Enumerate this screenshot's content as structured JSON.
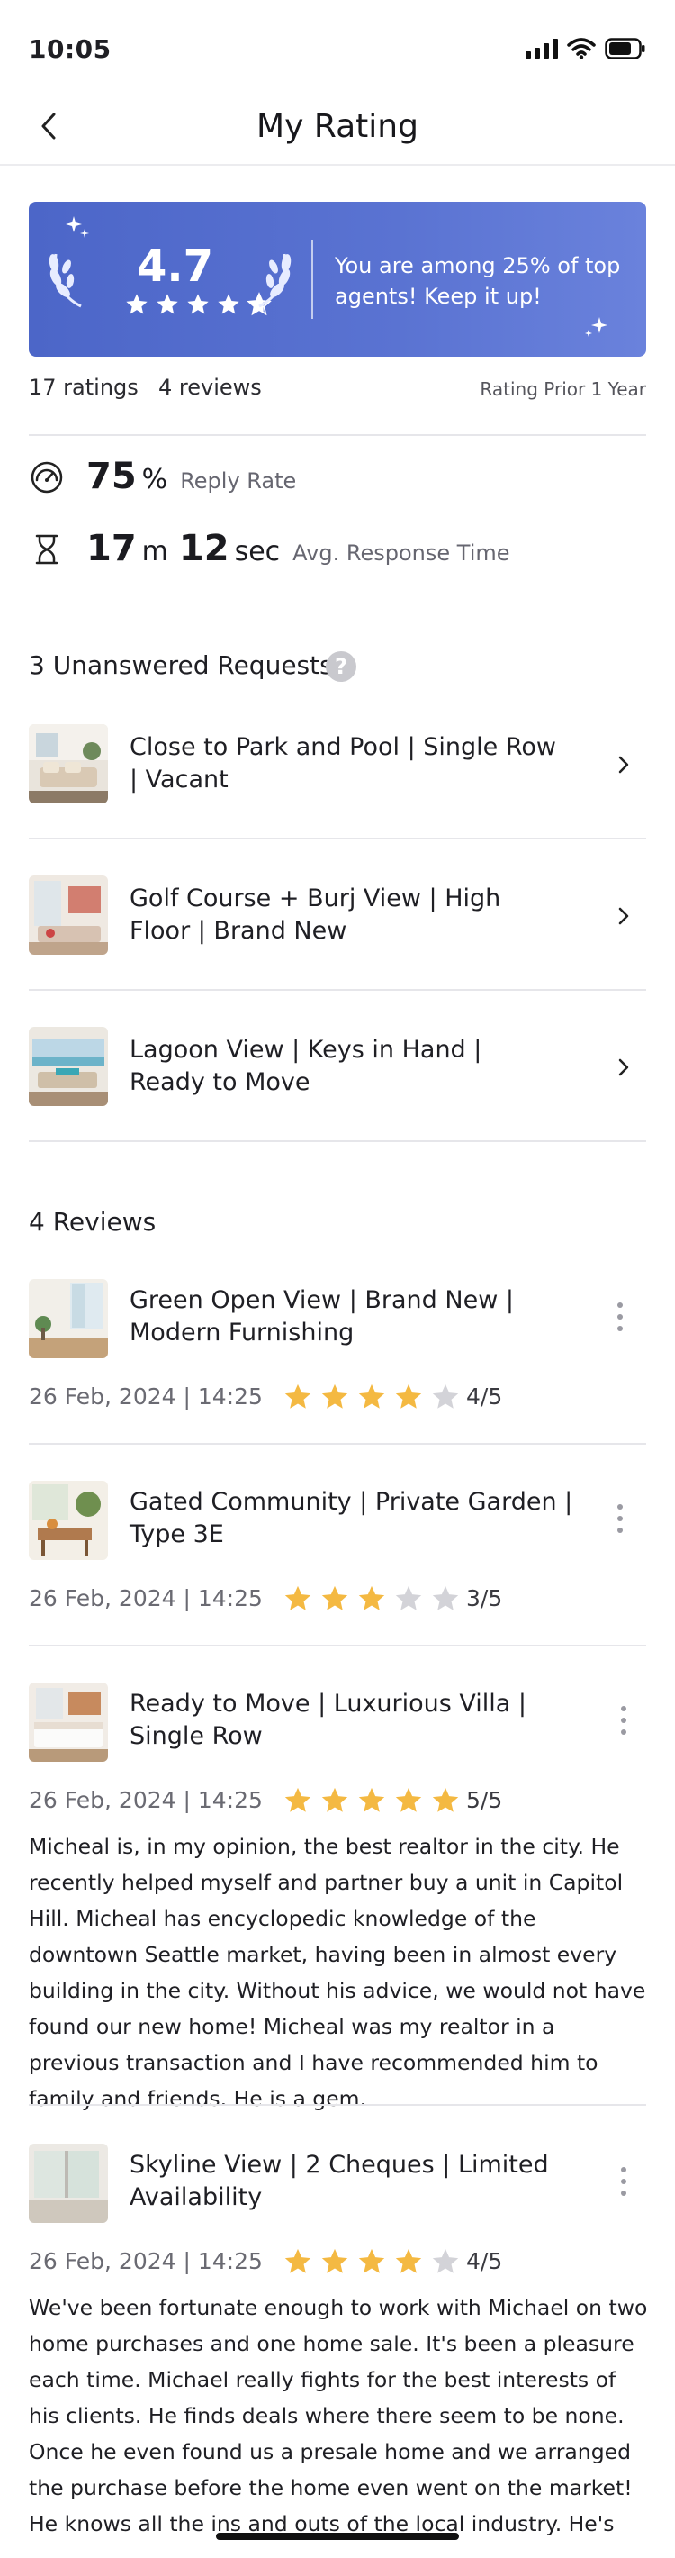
{
  "status_bar": {
    "time": "10:05"
  },
  "header": {
    "title": "My Rating"
  },
  "rating_card": {
    "score": "4.7",
    "stars_value": 4.7,
    "message": "You are among 25% of top agents! Keep it up!",
    "accent_color": "#4c66c8"
  },
  "summary": {
    "ratings_count": "17 ratings",
    "reviews_count": "4 reviews",
    "period": "Rating Prior 1 Year"
  },
  "reply_rate": {
    "value": "75",
    "unit": "%",
    "label": "Reply Rate"
  },
  "response_time": {
    "minutes": "17",
    "minutes_unit": "m",
    "seconds": "12",
    "seconds_unit": "sec",
    "label": "Avg. Response Time"
  },
  "unanswered": {
    "title": "3 Unanswered Requests",
    "items": [
      {
        "title": "Close to Park and Pool | Single Row | Vacant"
      },
      {
        "title": "Golf Course + Burj View | High Floor | Brand New"
      },
      {
        "title": "Lagoon View | Keys in Hand | Ready to Move"
      }
    ]
  },
  "reviews": {
    "title": "4 Reviews",
    "items": [
      {
        "title": "Green Open View | Brand New | Modern Furnishing",
        "date": "26 Feb, 2024 | 14:25",
        "rating": 4,
        "score": "4/5",
        "text": ""
      },
      {
        "title": "Gated Community | Private Garden | Type 3E",
        "date": "26 Feb, 2024 | 14:25",
        "rating": 3,
        "score": "3/5",
        "text": ""
      },
      {
        "title": "Ready to Move | Luxurious Villa | Single Row",
        "date": "26 Feb, 2024 | 14:25",
        "rating": 5,
        "score": "5/5",
        "text": "Micheal is, in my opinion, the best realtor in the city. He recently helped myself and partner buy a unit in Capitol Hill. Micheal has encyclopedic knowledge of the downtown Seattle market, having been in almost every building in the city. Without his advice, we would not have found our new home! Micheal was my realtor in a previous transaction and I have recommended him to family and friends. He is a gem."
      },
      {
        "title": "Skyline View | 2 Cheques | Limited Availability",
        "date": "26 Feb, 2024 | 14:25",
        "rating": 4,
        "score": "4/5",
        "text": "We've been fortunate enough to work with Michael on two home purchases and one home sale. It's been a pleasure each time. Michael really fights for the best interests of his clients. He finds deals where there seem to be none. Once he even found us a presale home and we arranged the purchase before the home even went on the market! He knows all the ins and outs of the local industry. He's recommended contractors for all our needs, and they've all"
      }
    ]
  },
  "colors": {
    "star_filled": "#f4b942",
    "star_empty": "#d3d3d8",
    "divider": "#e6e6ea"
  }
}
